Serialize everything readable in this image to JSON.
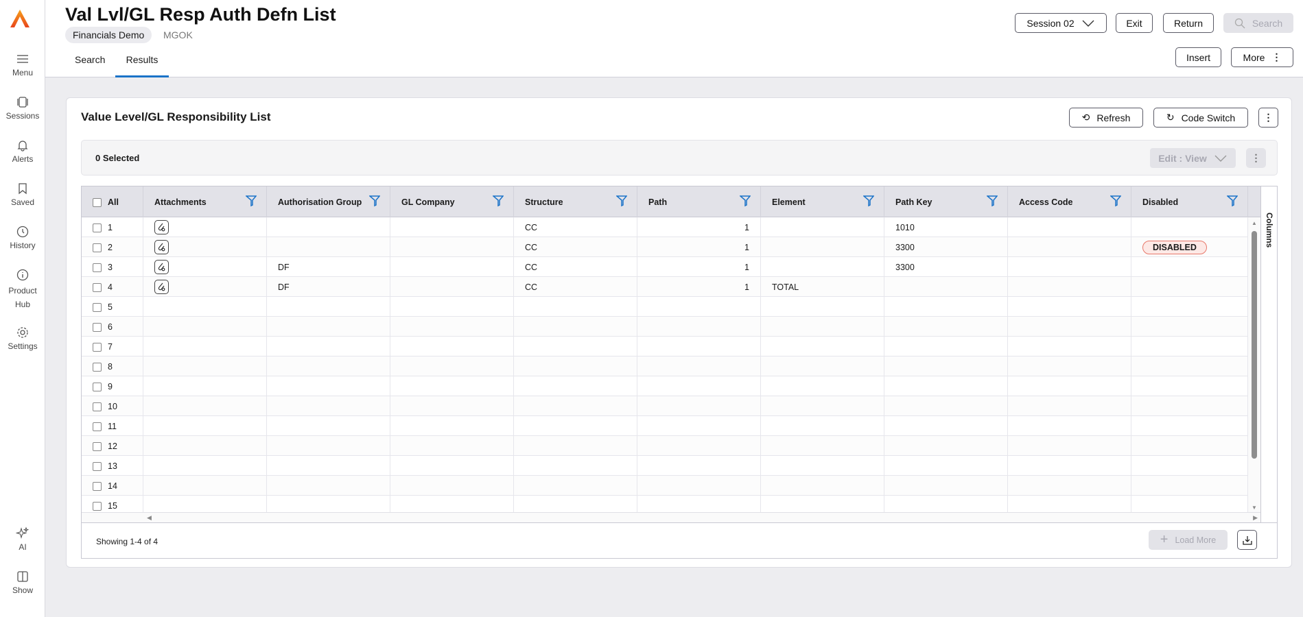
{
  "sidebar": {
    "items": [
      {
        "label": "Menu",
        "icon": "menu-icon"
      },
      {
        "label": "Sessions",
        "icon": "sessions-icon"
      },
      {
        "label": "Alerts",
        "icon": "bell-icon"
      },
      {
        "label": "Saved",
        "icon": "bookmark-icon"
      },
      {
        "label": "History",
        "icon": "clock-icon"
      },
      {
        "label": "Product Hub",
        "icon": "info-icon"
      },
      {
        "label": "Settings",
        "icon": "gear-icon"
      },
      {
        "label": "AI",
        "icon": "sparkle-icon"
      },
      {
        "label": "Show",
        "icon": "panel-icon"
      }
    ]
  },
  "header": {
    "title": "Val Lvl/GL Resp Auth Defn List",
    "chip": "Financials Demo",
    "sub": "MGOK",
    "tabs": [
      "Search",
      "Results"
    ],
    "session": "Session 02",
    "exit": "Exit",
    "return": "Return",
    "search": "Search",
    "insert": "Insert",
    "more": "More"
  },
  "card": {
    "title": "Value Level/GL Responsibility List",
    "refresh": "Refresh",
    "code_switch": "Code Switch",
    "selected": "0 Selected",
    "edit_view": "Edit : View",
    "columns": "Columns",
    "showing": "Showing 1-4 of 4",
    "load_more": "Load More"
  },
  "table": {
    "all_label": "All",
    "columns": [
      "Attachments",
      "Authorisation Group",
      "GL Company",
      "Structure",
      "Path",
      "Element",
      "Path Key",
      "Access Code",
      "Disabled"
    ],
    "rows": [
      {
        "n": "1",
        "auth": "",
        "glco": "",
        "structure": "CC",
        "path": "1",
        "element": "",
        "pathkey": "1010",
        "access": "",
        "disabled": ""
      },
      {
        "n": "2",
        "auth": "",
        "glco": "",
        "structure": "CC",
        "path": "1",
        "element": "",
        "pathkey": "3300",
        "access": "",
        "disabled": "DISABLED"
      },
      {
        "n": "3",
        "auth": "DF",
        "glco": "",
        "structure": "CC",
        "path": "1",
        "element": "",
        "pathkey": "3300",
        "access": "",
        "disabled": ""
      },
      {
        "n": "4",
        "auth": "DF",
        "glco": "",
        "structure": "CC",
        "path": "1",
        "element": "TOTAL",
        "pathkey": "",
        "access": "",
        "disabled": ""
      }
    ],
    "empty_rows": [
      "5",
      "6",
      "7",
      "8",
      "9",
      "10",
      "11",
      "12",
      "13",
      "14",
      "15"
    ]
  },
  "colors": {
    "accent": "#1a73c8",
    "logo": "#f05a1e",
    "badge_border": "#e8786a"
  }
}
